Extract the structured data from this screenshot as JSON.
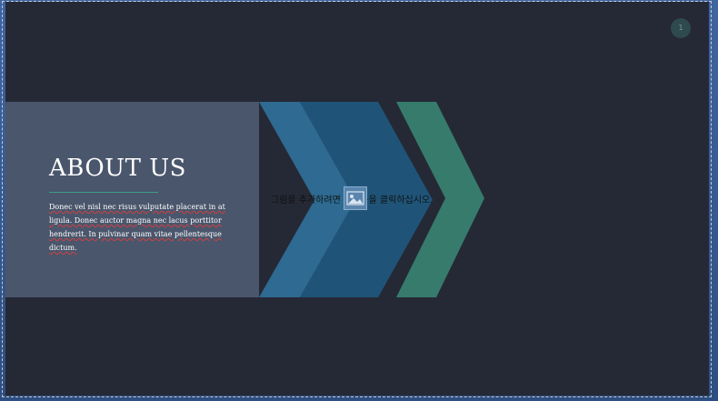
{
  "slide": {
    "title": "ABOUT US",
    "body": "Donec vel nisl nec risus vulputate placerat in at ligula. Donec auctor magna nec lacus porttitor hendrerit. In pulvinar quam vitae pellentesque dictum.",
    "picture_placeholder": "그림을 추가하려면 아이콘을 클릭하십시오.",
    "slide_number": "1"
  },
  "colors": {
    "background": "#252935",
    "panel": "#4a566c",
    "chevron_light": "#2e6a91",
    "chevron_dark": "#1f5478",
    "chevron_green": "#377b6c",
    "accent_rule": "#3f9b8a"
  },
  "icons": {
    "placeholder_icon": "picture-placeholder-icon"
  }
}
